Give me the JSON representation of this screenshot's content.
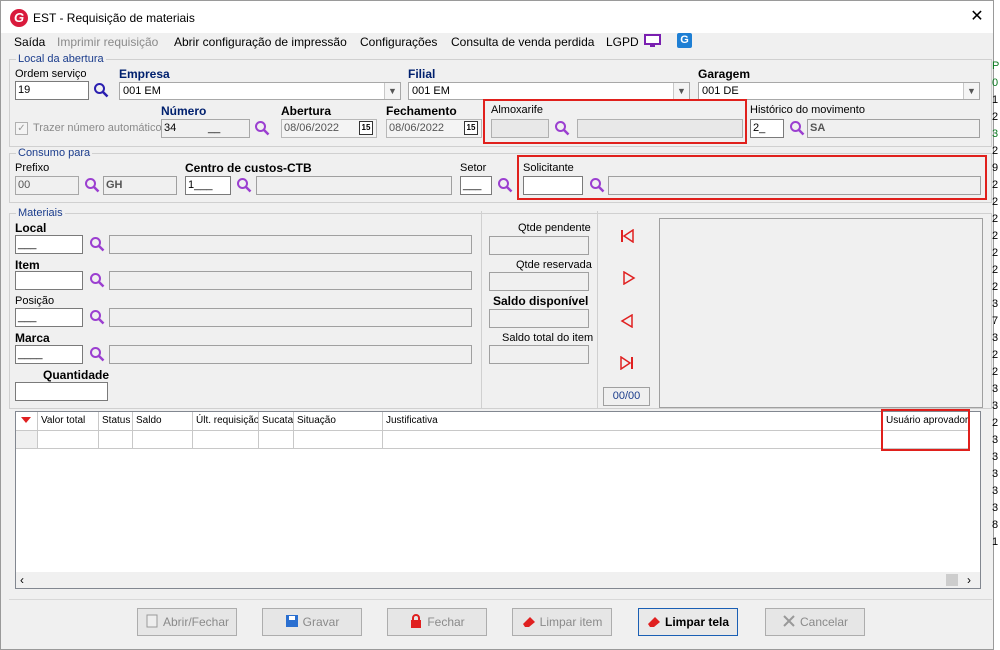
{
  "window": {
    "title": "EST - Requisição de materiais",
    "logo_letter": "G",
    "close_glyph": "✕"
  },
  "menu": {
    "saida": "Saída",
    "imprimir": "Imprimir requisição",
    "abrir_config": "Abrir configuração de impressão",
    "configuracoes": "Configurações",
    "consulta": "Consulta de venda perdida",
    "lgpd": "LGPD"
  },
  "local_abertura": {
    "legend": "Local da abertura",
    "ordem_servico": {
      "label": "Ordem serviço",
      "value": "19"
    },
    "empresa": {
      "label": "Empresa",
      "value": "001 EM"
    },
    "filial": {
      "label": "Filial",
      "value": "001 EM"
    },
    "garagem": {
      "label": "Garagem",
      "value": "001 DE"
    },
    "trazer_numero": {
      "label": "Trazer número automático",
      "checked": true
    },
    "numero": {
      "label": "Número",
      "value": "34",
      "suffix": "__"
    },
    "abertura": {
      "label": "Abertura",
      "value": "08/06/2022",
      "cal": "15"
    },
    "fechamento": {
      "label": "Fechamento",
      "value": "08/06/2022",
      "cal": "15"
    },
    "almoxarife": {
      "label": "Almoxarife"
    },
    "historico": {
      "label": "Histórico do movimento",
      "code": "2_",
      "desc": "SA"
    }
  },
  "consumo": {
    "legend": "Consumo para",
    "prefixo": {
      "label": "Prefixo",
      "value": "00",
      "desc": "GH"
    },
    "centro": {
      "label": "Centro de custos-CTB",
      "value": "1___"
    },
    "setor": {
      "label": "Setor",
      "value": "___"
    },
    "solicitante": {
      "label": "Solicitante"
    }
  },
  "materiais": {
    "legend": "Materiais",
    "local": {
      "label": "Local",
      "value": "___"
    },
    "item": {
      "label": "Item"
    },
    "posicao": {
      "label": "Posição",
      "value": "___"
    },
    "marca": {
      "label": "Marca",
      "value": "____"
    },
    "quantidade": {
      "label": "Quantidade"
    },
    "qtde_pendente": "Qtde pendente",
    "qtde_reservada": "Qtde reservada",
    "saldo_disponivel": "Saldo disponível",
    "saldo_total": "Saldo total do item",
    "counter": "00/00"
  },
  "grid": {
    "columns": [
      "Valor total",
      "Status",
      "Saldo",
      "Últ. requisição",
      "Sucata",
      "Situação",
      "Justificativa",
      "Usuário aprovador"
    ]
  },
  "buttons": {
    "abrir_fechar": "Abrir/Fechar",
    "gravar": "Gravar",
    "fechar": "Fechar",
    "limpar_item": "Limpar item",
    "limpar_tela": "Limpar tela",
    "cancelar": "Cancelar"
  },
  "side_digits": [
    "P",
    "0",
    "1",
    "2",
    "3",
    "2",
    "9",
    "2",
    "2",
    "2",
    "2",
    "2",
    "2",
    "2",
    "3",
    "7",
    "3",
    "2",
    "2",
    "3",
    "3",
    "2",
    "3",
    "3",
    "3",
    "3",
    "3",
    "8",
    "1"
  ],
  "colors": {
    "accent_red": "#e0201c",
    "header_blue": "#00206e",
    "legend_blue": "#1a3c8c",
    "search_icon": "#9b3fd0"
  }
}
